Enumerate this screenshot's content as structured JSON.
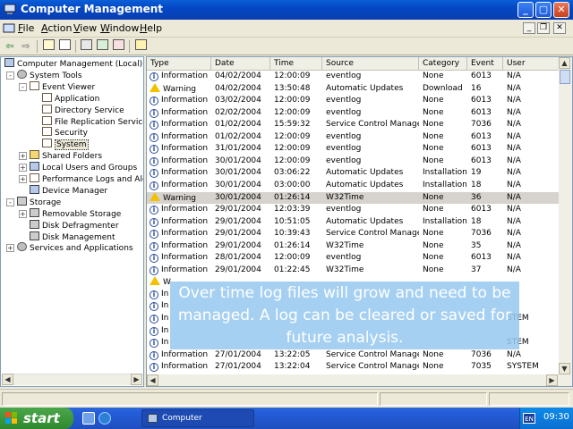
{
  "window": {
    "title": "Computer Management"
  },
  "menu": [
    {
      "label": "File",
      "u": "F",
      "rest": "ile"
    },
    {
      "label": "Action",
      "u": "A",
      "rest": "ction"
    },
    {
      "label": "View",
      "u": "V",
      "rest": "iew"
    },
    {
      "label": "Window",
      "u": "W",
      "rest": "indow"
    },
    {
      "label": "Help",
      "u": "H",
      "rest": "elp"
    }
  ],
  "toolbar_icons": [
    "back-arrow-icon",
    "forward-arrow-icon",
    "up-folder-icon",
    "show-hide-tree-icon",
    "properties-icon",
    "refresh-icon",
    "export-list-icon",
    "help-icon"
  ],
  "tree": [
    {
      "label": "Computer Management (Local)",
      "level": 0,
      "icon": "comp",
      "exp": ""
    },
    {
      "label": "System Tools",
      "level": 1,
      "icon": "gear",
      "exp": "-"
    },
    {
      "label": "Event Viewer",
      "level": 2,
      "icon": "log",
      "exp": "-"
    },
    {
      "label": "Application",
      "level": 3,
      "icon": "log",
      "exp": ""
    },
    {
      "label": "Directory Service",
      "level": 3,
      "icon": "log",
      "exp": ""
    },
    {
      "label": "File Replication Service",
      "level": 3,
      "icon": "log",
      "exp": ""
    },
    {
      "label": "Security",
      "level": 3,
      "icon": "log",
      "exp": ""
    },
    {
      "label": "System",
      "level": 3,
      "icon": "log",
      "exp": "",
      "selected": true
    },
    {
      "label": "Shared Folders",
      "level": 2,
      "icon": "folder",
      "exp": "+"
    },
    {
      "label": "Local Users and Groups",
      "level": 2,
      "icon": "comp",
      "exp": "+"
    },
    {
      "label": "Performance Logs and Alerts",
      "level": 2,
      "icon": "log",
      "exp": "+"
    },
    {
      "label": "Device Manager",
      "level": 2,
      "icon": "comp",
      "exp": ""
    },
    {
      "label": "Storage",
      "level": 1,
      "icon": "disk",
      "exp": "-"
    },
    {
      "label": "Removable Storage",
      "level": 2,
      "icon": "disk",
      "exp": "+"
    },
    {
      "label": "Disk Defragmenter",
      "level": 2,
      "icon": "disk",
      "exp": ""
    },
    {
      "label": "Disk Management",
      "level": 2,
      "icon": "disk",
      "exp": ""
    },
    {
      "label": "Services and Applications",
      "level": 1,
      "icon": "gear",
      "exp": "+"
    }
  ],
  "columns": [
    "Type",
    "Date",
    "Time",
    "Source",
    "Category",
    "Event",
    "User"
  ],
  "events": [
    [
      "Information",
      "04/02/2004",
      "12:00:09",
      "eventlog",
      "None",
      "6013",
      "N/A"
    ],
    [
      "Warning",
      "04/02/2004",
      "13:50:48",
      "Automatic Updates",
      "Download",
      "16",
      "N/A"
    ],
    [
      "Information",
      "03/02/2004",
      "12:00:09",
      "eventlog",
      "None",
      "6013",
      "N/A"
    ],
    [
      "Information",
      "02/02/2004",
      "12:00:09",
      "eventlog",
      "None",
      "6013",
      "N/A"
    ],
    [
      "Information",
      "01/02/2004",
      "15:59:32",
      "Service Control Manager",
      "None",
      "7036",
      "N/A"
    ],
    [
      "Information",
      "01/02/2004",
      "12:00:09",
      "eventlog",
      "None",
      "6013",
      "N/A"
    ],
    [
      "Information",
      "31/01/2004",
      "12:00:09",
      "eventlog",
      "None",
      "6013",
      "N/A"
    ],
    [
      "Information",
      "30/01/2004",
      "12:00:09",
      "eventlog",
      "None",
      "6013",
      "N/A"
    ],
    [
      "Information",
      "30/01/2004",
      "03:06:22",
      "Automatic Updates",
      "Installation",
      "19",
      "N/A"
    ],
    [
      "Information",
      "30/01/2004",
      "03:00:00",
      "Automatic Updates",
      "Installation",
      "18",
      "N/A"
    ],
    [
      "Warning",
      "30/01/2004",
      "01:26:14",
      "W32Time",
      "None",
      "36",
      "N/A"
    ],
    [
      "Information",
      "29/01/2004",
      "12:03:39",
      "eventlog",
      "None",
      "6013",
      "N/A"
    ],
    [
      "Information",
      "29/01/2004",
      "10:51:05",
      "Automatic Updates",
      "Installation",
      "18",
      "N/A"
    ],
    [
      "Information",
      "29/01/2004",
      "10:39:43",
      "Service Control Manager",
      "None",
      "7036",
      "N/A"
    ],
    [
      "Information",
      "29/01/2004",
      "01:26:14",
      "W32Time",
      "None",
      "35",
      "N/A"
    ],
    [
      "Information",
      "28/01/2004",
      "12:00:09",
      "eventlog",
      "None",
      "6013",
      "N/A"
    ],
    [
      "Information",
      "29/01/2004",
      "01:22:45",
      "W32Time",
      "None",
      "37",
      "N/A"
    ],
    [
      "W",
      "",
      "",
      "",
      "",
      "",
      ""
    ],
    [
      "In",
      "",
      "",
      "",
      "",
      "",
      ""
    ],
    [
      "In",
      "",
      "",
      "",
      "",
      "",
      ""
    ],
    [
      "In",
      "",
      "",
      "",
      "",
      "",
      "STEM"
    ],
    [
      "In",
      "",
      "",
      "",
      "",
      "",
      ""
    ],
    [
      "In",
      "",
      "",
      "",
      "",
      "",
      "STEM"
    ],
    [
      "Information",
      "27/01/2004",
      "13:22:05",
      "Service Control Manager",
      "None",
      "7036",
      "N/A"
    ],
    [
      "Information",
      "27/01/2004",
      "13:22:04",
      "Service Control Manager",
      "None",
      "7035",
      "SYSTEM"
    ]
  ],
  "overlay_text": "Over time log files will grow and need to be managed. A log can be cleared or saved for future analysis.",
  "taskbar": {
    "start_label": "start",
    "task_button": "Computer Management",
    "language": "EN",
    "clock": "09:30"
  }
}
